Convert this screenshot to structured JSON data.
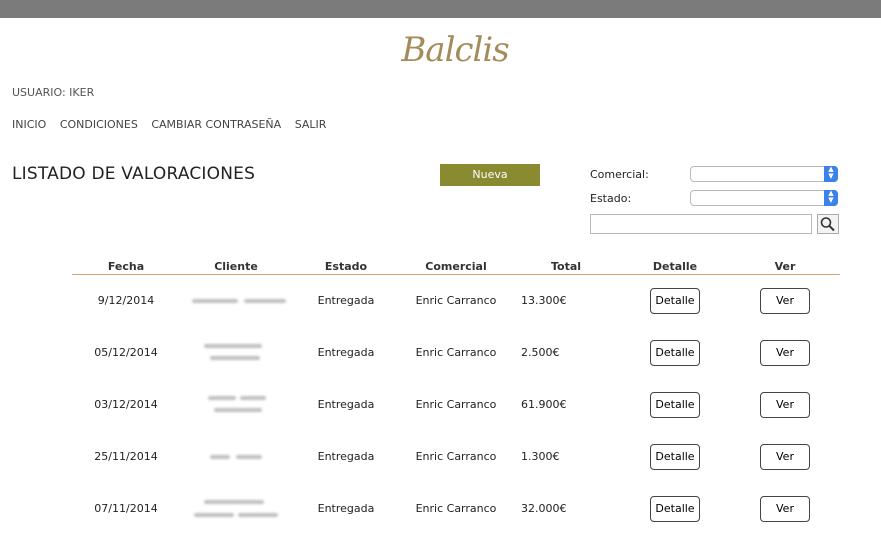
{
  "brand": {
    "logo": "Balclis"
  },
  "user": {
    "label": "USUARIO: IKER"
  },
  "nav": {
    "items": [
      "INICIO",
      "CONDICIONES",
      "CAMBIAR CONTRASEÑA",
      "SALIR"
    ]
  },
  "page": {
    "title": "LISTADO DE VALORACIONES",
    "new_button": "Nueva"
  },
  "filters": {
    "comercial_label": "Comercial:",
    "estado_label": "Estado:",
    "search_value": ""
  },
  "table": {
    "headers": [
      "Fecha",
      "Cliente",
      "Estado",
      "Comercial",
      "Total",
      "Detalle",
      "Ver"
    ],
    "rows": [
      {
        "fecha": "9/12/2014",
        "estado": "Entregada",
        "comercial": "Enric Carranco",
        "total": "13.300€",
        "detalle": "Detalle",
        "ver": "Ver"
      },
      {
        "fecha": "05/12/2014",
        "estado": "Entregada",
        "comercial": "Enric Carranco",
        "total": "2.500€",
        "detalle": "Detalle",
        "ver": "Ver"
      },
      {
        "fecha": "03/12/2014",
        "estado": "Entregada",
        "comercial": "Enric Carranco",
        "total": "61.900€",
        "detalle": "Detalle",
        "ver": "Ver"
      },
      {
        "fecha": "25/11/2014",
        "estado": "Entregada",
        "comercial": "Enric Carranco",
        "total": "1.300€",
        "detalle": "Detalle",
        "ver": "Ver"
      },
      {
        "fecha": "07/11/2014",
        "estado": "Entregada",
        "comercial": "Enric Carranco",
        "total": "32.000€",
        "detalle": "Detalle",
        "ver": "Ver"
      }
    ]
  },
  "colors": {
    "brand_gold": "#a38c5a",
    "button_olive": "#8a8a30",
    "rule_orange": "#e0a070",
    "select_blue": "#3c82e8"
  },
  "icons": {
    "search": "magnifier-icon",
    "select_arrow": "updown-chevron-icon"
  }
}
